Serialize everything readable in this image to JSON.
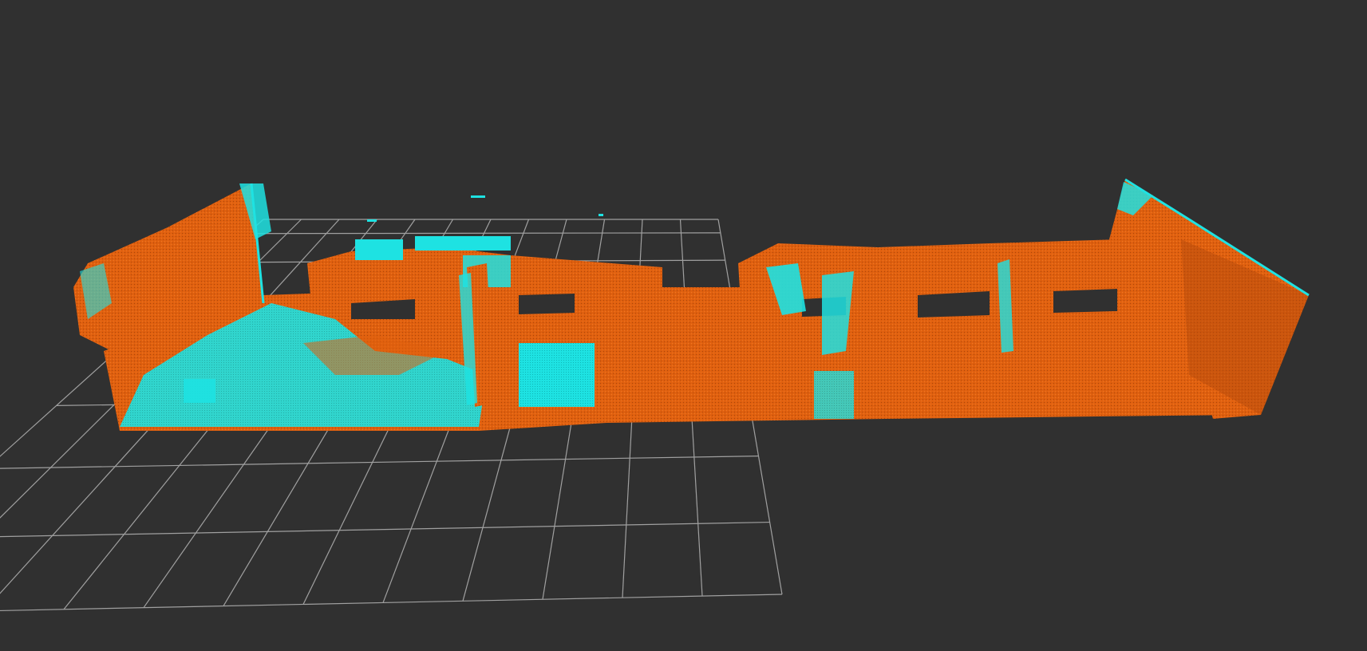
{
  "viewer": {
    "background_color": "#303030",
    "grid_color": "#a0a0a0",
    "point_colors": {
      "primary": "#e06010",
      "primary_dark": "#b84a08",
      "secondary": "#18e0e0"
    },
    "content": "point-cloud-map"
  }
}
